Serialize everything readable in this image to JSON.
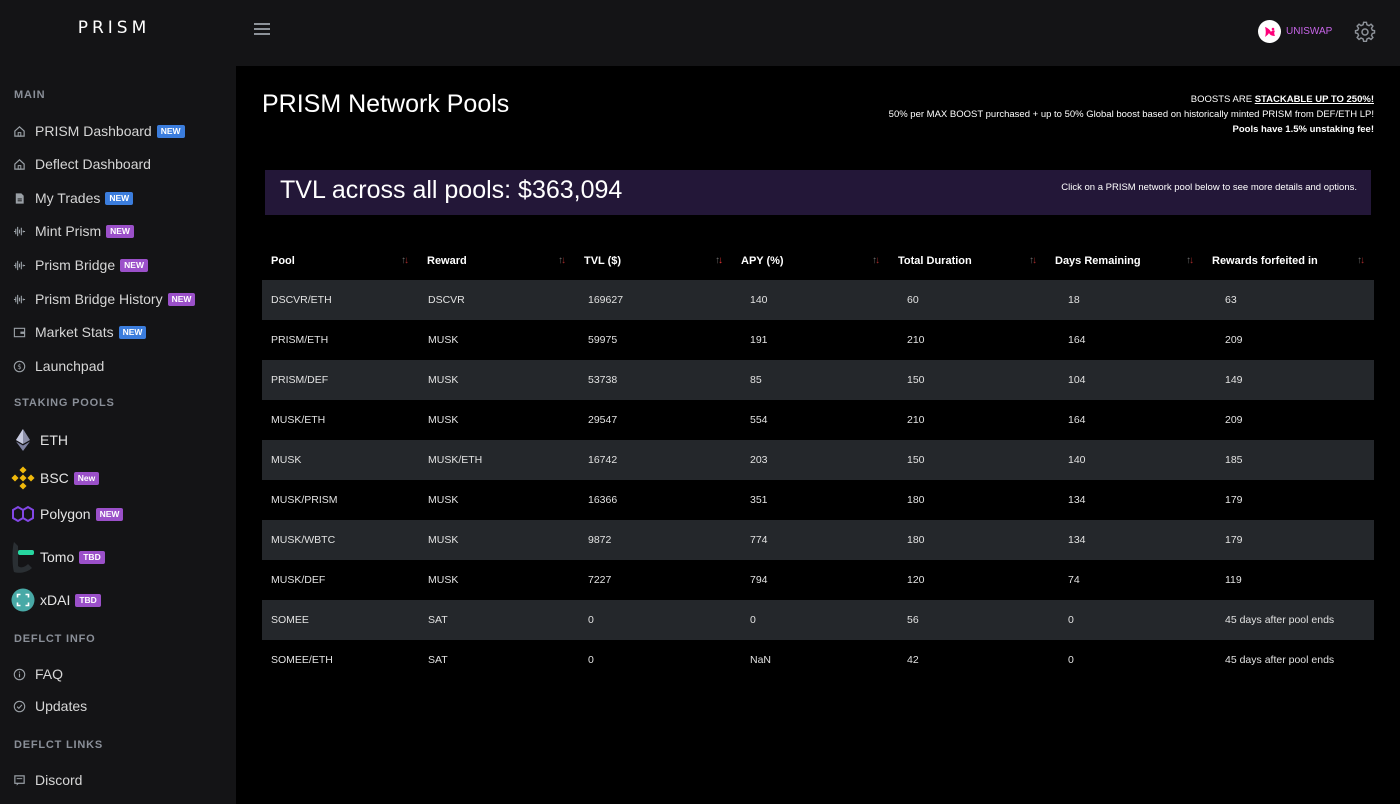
{
  "app": {
    "logo": "PRISM"
  },
  "sidebar": {
    "sections": [
      "MAIN",
      "STAKING POOLS",
      "DEFLCT INFO",
      "DEFLCT LINKS"
    ],
    "main_items": [
      {
        "label": "PRISM Dashboard",
        "badge": "NEW",
        "icon": "home-icon"
      },
      {
        "label": "Deflect Dashboard",
        "badge": "",
        "icon": "home-icon"
      },
      {
        "label": "My Trades",
        "badge": "NEW",
        "icon": "document-icon"
      },
      {
        "label": "Mint Prism",
        "badge": "NEW",
        "icon": "activity-icon"
      },
      {
        "label": "Prism Bridge",
        "badge": "NEW",
        "icon": "activity-icon"
      },
      {
        "label": "Prism Bridge History",
        "badge": "NEW",
        "icon": "activity-icon"
      },
      {
        "label": "Market Stats",
        "badge": "NEW",
        "icon": "wallet-icon"
      },
      {
        "label": "Launchpad",
        "badge": "",
        "icon": "dollar-circle-icon"
      }
    ],
    "pool_items": [
      {
        "label": "ETH",
        "badge": "",
        "icon": "ethereum-icon"
      },
      {
        "label": "BSC",
        "badge": "New",
        "icon": "binance-icon"
      },
      {
        "label": "Polygon",
        "badge": "NEW",
        "icon": "polygon-icon"
      },
      {
        "label": "Tomo",
        "badge": "TBD",
        "icon": "tomo-icon"
      },
      {
        "label": "xDAI",
        "badge": "TBD",
        "icon": "xdai-icon"
      }
    ],
    "info_items": [
      {
        "label": "FAQ",
        "icon": "info-icon"
      },
      {
        "label": "Updates",
        "icon": "check-circle-icon"
      }
    ],
    "link_items": [
      {
        "label": "Discord",
        "icon": "chat-icon"
      }
    ]
  },
  "topbar": {
    "exchange_label": "UNISWAP",
    "icons": [
      "hamburger-icon",
      "uniswap-icon",
      "gear-icon"
    ]
  },
  "main": {
    "title": "PRISM Network Pools",
    "boost": {
      "line1_prefix": "BOOSTS ARE ",
      "line1_emphasis": "STACKABLE UP TO 250%!",
      "line2": "50% per MAX BOOST purchased + up to 50% Global boost based on historically minted PRISM from DEF/ETH LP!",
      "line3": "Pools have 1.5% unstaking fee!"
    },
    "tvl_text": "TVL across all pools: $363,094",
    "tvl_hint": "Click on a PRISM network pool below to see more details and options."
  },
  "table": {
    "columns": [
      "Pool",
      "Reward",
      "TVL ($)",
      "APY (%)",
      "Total Duration",
      "Days Remaining",
      "Rewards forfeited in"
    ],
    "rows": [
      [
        "DSCVR/ETH",
        "DSCVR",
        "169627",
        "140",
        "60",
        "18",
        "63"
      ],
      [
        "PRISM/ETH",
        "MUSK",
        "59975",
        "191",
        "210",
        "164",
        "209"
      ],
      [
        "PRISM/DEF",
        "MUSK",
        "53738",
        "85",
        "150",
        "104",
        "149"
      ],
      [
        "MUSK/ETH",
        "MUSK",
        "29547",
        "554",
        "210",
        "164",
        "209"
      ],
      [
        "MUSK",
        "MUSK/ETH",
        "16742",
        "203",
        "150",
        "140",
        "185"
      ],
      [
        "MUSK/PRISM",
        "MUSK",
        "16366",
        "351",
        "180",
        "134",
        "179"
      ],
      [
        "MUSK/WBTC",
        "MUSK",
        "9872",
        "774",
        "180",
        "134",
        "179"
      ],
      [
        "MUSK/DEF",
        "MUSK",
        "7227",
        "794",
        "120",
        "74",
        "119"
      ],
      [
        "SOMEE",
        "SAT",
        "0",
        "0",
        "56",
        "0",
        "45 days after pool ends"
      ],
      [
        "SOMEE/ETH",
        "SAT",
        "0",
        "NaN",
        "42",
        "0",
        "45 days after pool ends"
      ]
    ]
  },
  "colors": {
    "sidebar_bg": "#141416",
    "banner_bg": "#231738",
    "row_alt_bg": "#24272b",
    "badge_blue": "#3b7ddd",
    "badge_purple": "#9b50c9",
    "uniswap_pink": "#c765e8"
  }
}
